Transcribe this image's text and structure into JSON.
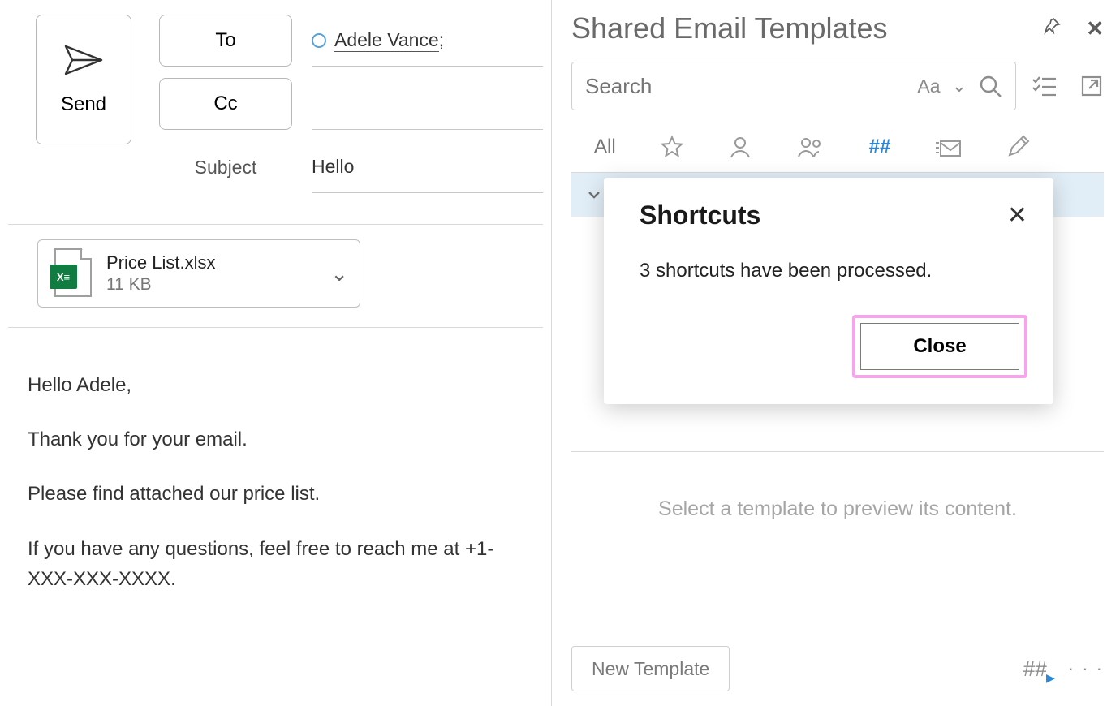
{
  "compose": {
    "send_label": "Send",
    "to_label": "To",
    "cc_label": "Cc",
    "subject_label": "Subject",
    "to_value": "Adele Vance",
    "to_suffix": ";",
    "cc_value": "",
    "subject_value": "Hello",
    "attachment": {
      "name": "Price List.xlsx",
      "size": "11 KB"
    },
    "body_lines": [
      "Hello Adele,",
      "Thank you for your email.",
      "Please find attached our price list.",
      "If you have any questions, feel free to reach me at +1-XXX-XXX-XXXX."
    ]
  },
  "panel": {
    "title": "Shared Email Templates",
    "search_placeholder": "Search",
    "case_label": "Aa",
    "tabs": {
      "all": "All",
      "hash": "##"
    },
    "preview_placeholder": "Select a template to preview its content.",
    "new_template_label": "New Template",
    "footer_hash": "##",
    "footer_dots": "· · ·"
  },
  "dialog": {
    "title": "Shortcuts",
    "message": "3 shortcuts have been processed.",
    "close_label": "Close"
  }
}
